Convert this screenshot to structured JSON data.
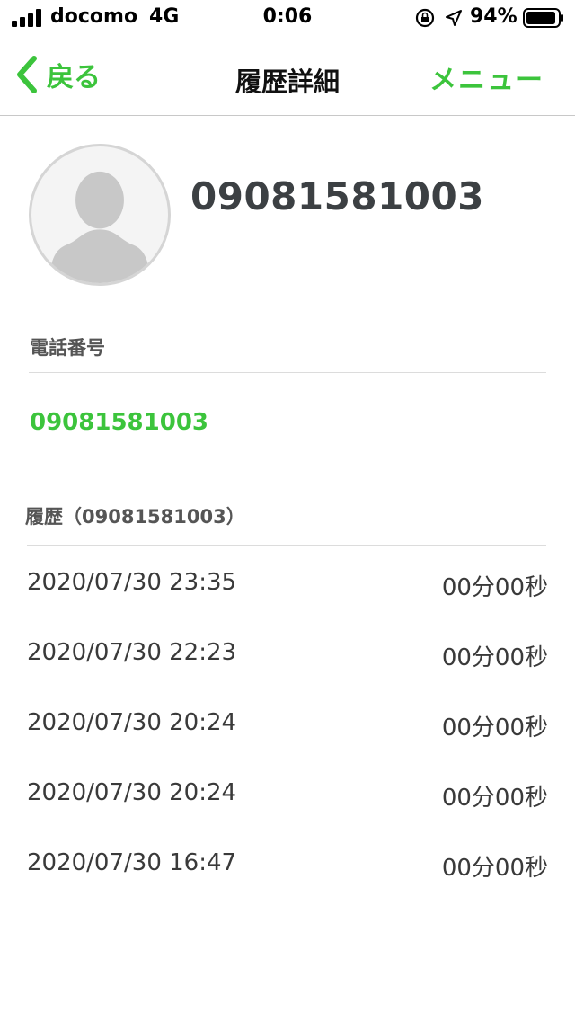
{
  "status_bar": {
    "carrier": "docomo",
    "network": "4G",
    "time": "0:06",
    "battery_percent": "94%",
    "battery_level": 0.94
  },
  "nav": {
    "back_label": "戻る",
    "title": "履歴詳細",
    "menu_label": "メニュー"
  },
  "contact": {
    "name": "09081581003"
  },
  "phone_section": {
    "label": "電話番号",
    "number": "09081581003"
  },
  "history_section": {
    "label": "履歴（09081581003）",
    "items": [
      {
        "datetime": "2020/07/30 23:35",
        "duration": "00分00秒"
      },
      {
        "datetime": "2020/07/30 22:23",
        "duration": "00分00秒"
      },
      {
        "datetime": "2020/07/30 20:24",
        "duration": "00分00秒"
      },
      {
        "datetime": "2020/07/30 20:24",
        "duration": "00分00秒"
      },
      {
        "datetime": "2020/07/30 16:47",
        "duration": "00分00秒"
      }
    ]
  },
  "colors": {
    "accent": "#3cc43c",
    "text": "#3a3a3a",
    "divider": "#dcdcdc"
  }
}
